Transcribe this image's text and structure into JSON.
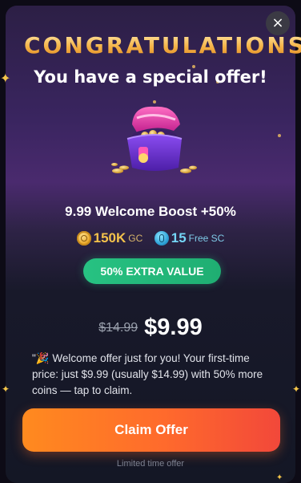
{
  "modal": {
    "close_glyph": "×",
    "title": "CONGRATULATIONS",
    "subtitle": "You have a special offer!",
    "offer_name": "9.99 Welcome Boost +50%",
    "rewards": {
      "gold": {
        "amount": "150K",
        "unit": "GC",
        "icon": "gold-coin-icon"
      },
      "sweeps": {
        "amount": "15",
        "unit": "Free SC",
        "icon": "sweeps-coin-icon"
      }
    },
    "extra_badge": "50% EXTRA VALUE",
    "original_price": "$14.99",
    "price": "$9.99",
    "description": "\"🎉 Welcome offer just for you! Your first-time price: just $9.99 (usually $14.99) with 50% more coins — tap to claim.",
    "claim_button": "Claim Offer",
    "footnote": "Limited time offer"
  },
  "colors": {
    "accent_orange": "#ff6a2c",
    "badge_green": "#27c282",
    "gold": "#f3c24b",
    "sweeps_blue": "#74d6f6"
  }
}
